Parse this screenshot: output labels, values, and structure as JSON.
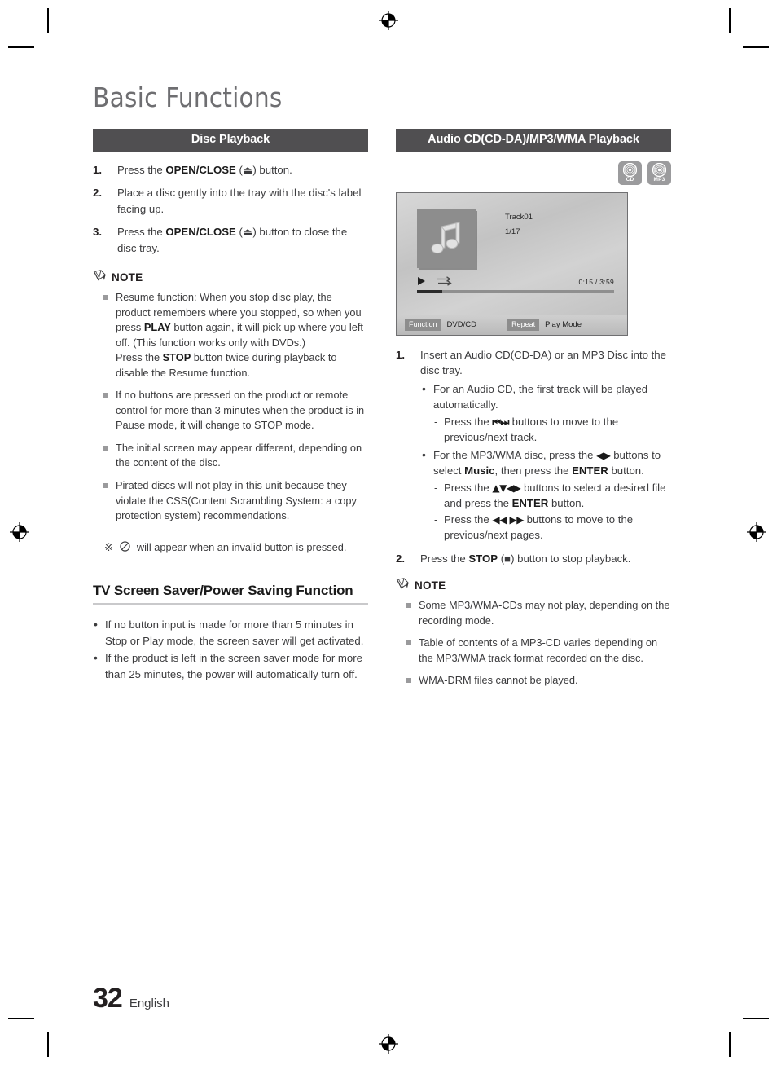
{
  "document": {
    "title": "Basic Functions",
    "page_number": "32",
    "language": "English"
  },
  "left_column": {
    "section_title": "Disc Playback",
    "steps": [
      {
        "num": "1.",
        "html": "Press the <b>OPEN/CLOSE</b> (⏏) button."
      },
      {
        "num": "2.",
        "html": "Place a disc gently into the tray with the disc's label facing up."
      },
      {
        "num": "3.",
        "html": "Press the <b>OPEN/CLOSE</b> (⏏) button to close the disc tray."
      }
    ],
    "note_label": "NOTE",
    "notes": [
      "Resume function: When you stop disc play, the product remembers where you stopped, so when you press <b>PLAY</b> button again, it will pick up where you left off. (This function works only with DVDs.)<br>Press the <b>STOP</b> button twice during playback to disable the Resume function.",
      "If no buttons are pressed on the product or remote control for more than 3 minutes when the product is in Pause mode, it will change to STOP mode.",
      "The initial screen may appear different, depending on the content of the disc.",
      "Pirated discs will not play in this unit because they violate the CSS(Content Scrambling System: a copy protection system) recommendations."
    ],
    "star_note": {
      "symbol": "※",
      "icon": "⊘",
      "text": "will appear when an invalid button is pressed."
    },
    "subsection_title": "TV Screen Saver/Power Saving Function",
    "subsection_bullets": [
      "If no button input is made for more than 5 minutes in Stop or Play mode, the screen saver will get activated.",
      "If the product is left in the screen saver mode for more than 25 minutes, the power will automatically turn off."
    ]
  },
  "right_column": {
    "section_title": "Audio CD(CD-DA)/MP3/WMA Playback",
    "badges": [
      {
        "label": "CD"
      },
      {
        "label": "MP3"
      }
    ],
    "tv_screen": {
      "track_title": "Track01",
      "track_count": "1/17",
      "time_elapsed": "0:15",
      "time_separator": "/",
      "time_total": "3:59",
      "function_chip": "Function",
      "function_value": "DVD/CD",
      "repeat_chip": "Repeat",
      "repeat_value": "Play Mode"
    },
    "steps": [
      {
        "num": "1.",
        "html": "Insert an Audio CD(CD-DA) or an MP3 Disc into the disc tray.",
        "sub_bullets": [
          {
            "html": "For an Audio CD, the first track will be played automatically.",
            "dashes": [
              "Press the <span class=\"glyph\"><b>⏮⏭</b></span> buttons to move to the previous/next track."
            ]
          },
          {
            "html": "For the MP3/WMA disc, press the <span class=\"glyph\"><b>◀▶</b></span> buttons to select <b>Music</b>, then press the <b>ENTER</b> button.",
            "dashes": [
              "Press the <span class=\"glyph\"><b>▲▼◀▶</b></span> buttons to select  a desired file and press the <b>ENTER</b> button.",
              "Press the <span class=\"glyph\"><b>◀◀ ▶▶</b></span> buttons to move to the previous/next pages."
            ]
          }
        ]
      },
      {
        "num": "2.",
        "html": "Press the <b>STOP</b> (■) button to stop playback.",
        "sub_bullets": []
      }
    ],
    "note_label": "NOTE",
    "notes": [
      "Some MP3/WMA-CDs may not play, depending on the recording mode.",
      "Table of contents of a MP3-CD varies depending on the MP3/WMA track format recorded on the disc.",
      "WMA-DRM files cannot be played."
    ]
  },
  "colors": {
    "section_bar": "#504f51",
    "title_gray": "#6e6e71",
    "body_text": "#3b3b3d",
    "badge_gray": "#9b9b9d"
  }
}
